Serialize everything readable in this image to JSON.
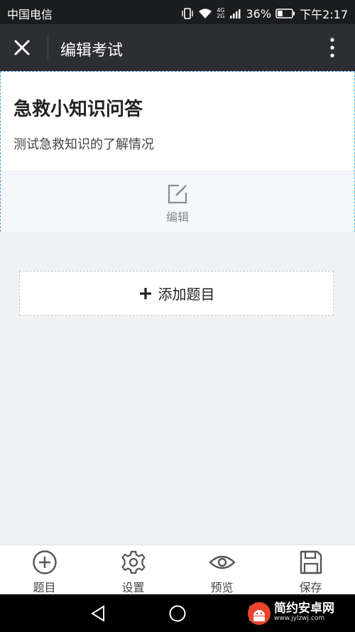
{
  "status": {
    "carrier": "中国电信",
    "network": "4G",
    "network2": "2G",
    "battery": "36%",
    "time": "下午2:17",
    "battery_level": 0.36
  },
  "header": {
    "title": "编辑考试"
  },
  "exam": {
    "title": "急救小知识问答",
    "description": "测试急救知识的了解情况",
    "edit_label": "编辑"
  },
  "actions": {
    "add_question": "添加题目"
  },
  "tabs": [
    {
      "label": "题目",
      "icon": "plus-circle-icon"
    },
    {
      "label": "设置",
      "icon": "gear-icon"
    },
    {
      "label": "预览",
      "icon": "eye-icon"
    },
    {
      "label": "保存",
      "icon": "floppy-disk-icon"
    }
  ],
  "watermark": {
    "brand": "简约安卓网",
    "url": "www.jylzwj.com"
  },
  "colors": {
    "accent": "#4aa3df",
    "titlebar": "#2d2e32",
    "background": "#f0f1f3"
  }
}
